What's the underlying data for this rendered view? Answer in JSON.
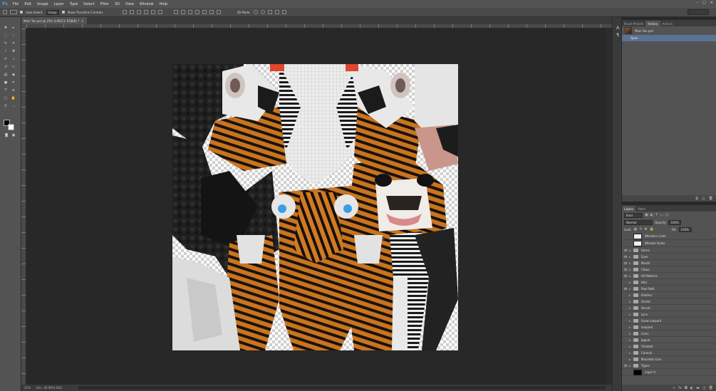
{
  "app": {
    "logo": "Ps"
  },
  "menu": [
    "File",
    "Edit",
    "Image",
    "Layer",
    "Type",
    "Select",
    "Filter",
    "3D",
    "View",
    "Window",
    "Help"
  ],
  "options": {
    "auto_select_label": "Auto-Select:",
    "auto_select_value": "Group",
    "transform_label": "Show Transform Controls",
    "mode_3d_label": "3D Mode:"
  },
  "document": {
    "tab_title": "Main Tex.psd @ 25% (LAB/13, RGB/8) *",
    "close_glyph": "×"
  },
  "status": {
    "zoom": "25%",
    "doc_size": "Doc: 48.0M/4.06G"
  },
  "history_panel": {
    "tabs": [
      "Brush Presets",
      "History",
      "Actions"
    ],
    "active_tab": "History",
    "snapshot_name": "Main Tex.psd",
    "steps": [
      "Open"
    ]
  },
  "layers_panel": {
    "tabs": [
      "Layers",
      "Paths"
    ],
    "active_tab": "Layers",
    "filter_label": "Kind",
    "blend_mode": "Normal",
    "opacity_label": "Opacity:",
    "opacity_value": "100%",
    "lock_label": "Lock:",
    "fill_label": "Fill:",
    "fill_value": "100%",
    "layers": [
      {
        "name": "Whiskers Color",
        "type": "layer",
        "visible": false
      },
      {
        "name": "Whisker Holes",
        "type": "layer",
        "visible": false
      },
      {
        "name": "Horns",
        "type": "group",
        "visible": true
      },
      {
        "name": "Eyes",
        "type": "group",
        "visible": true
      },
      {
        "name": "Mouth",
        "type": "group",
        "visible": true
      },
      {
        "name": "Claws",
        "type": "group",
        "visible": true
      },
      {
        "name": "All Patterns",
        "type": "group",
        "visible": true
      },
      {
        "name": "Hair",
        "type": "group",
        "visible": false
      },
      {
        "name": "Paw Pads",
        "type": "group",
        "visible": true
      },
      {
        "name": "Panther",
        "type": "group",
        "visible": false
      },
      {
        "name": "Ocelot",
        "type": "group",
        "visible": false
      },
      {
        "name": "Serval",
        "type": "group",
        "visible": false
      },
      {
        "name": "Lynx",
        "type": "group",
        "visible": false
      },
      {
        "name": "Snow Leopard",
        "type": "group",
        "visible": false
      },
      {
        "name": "Leopard",
        "type": "group",
        "visible": false
      },
      {
        "name": "Lions",
        "type": "group",
        "visible": false
      },
      {
        "name": "Jaguar",
        "type": "group",
        "visible": false
      },
      {
        "name": "Cheetah",
        "type": "group",
        "visible": false
      },
      {
        "name": "Caracal",
        "type": "group",
        "visible": false
      },
      {
        "name": "Mountain Lion",
        "type": "group",
        "visible": false
      },
      {
        "name": "Tigers",
        "type": "group",
        "visible": true
      },
      {
        "name": "Layer 0",
        "type": "layer",
        "visible": false,
        "black": true
      }
    ]
  }
}
